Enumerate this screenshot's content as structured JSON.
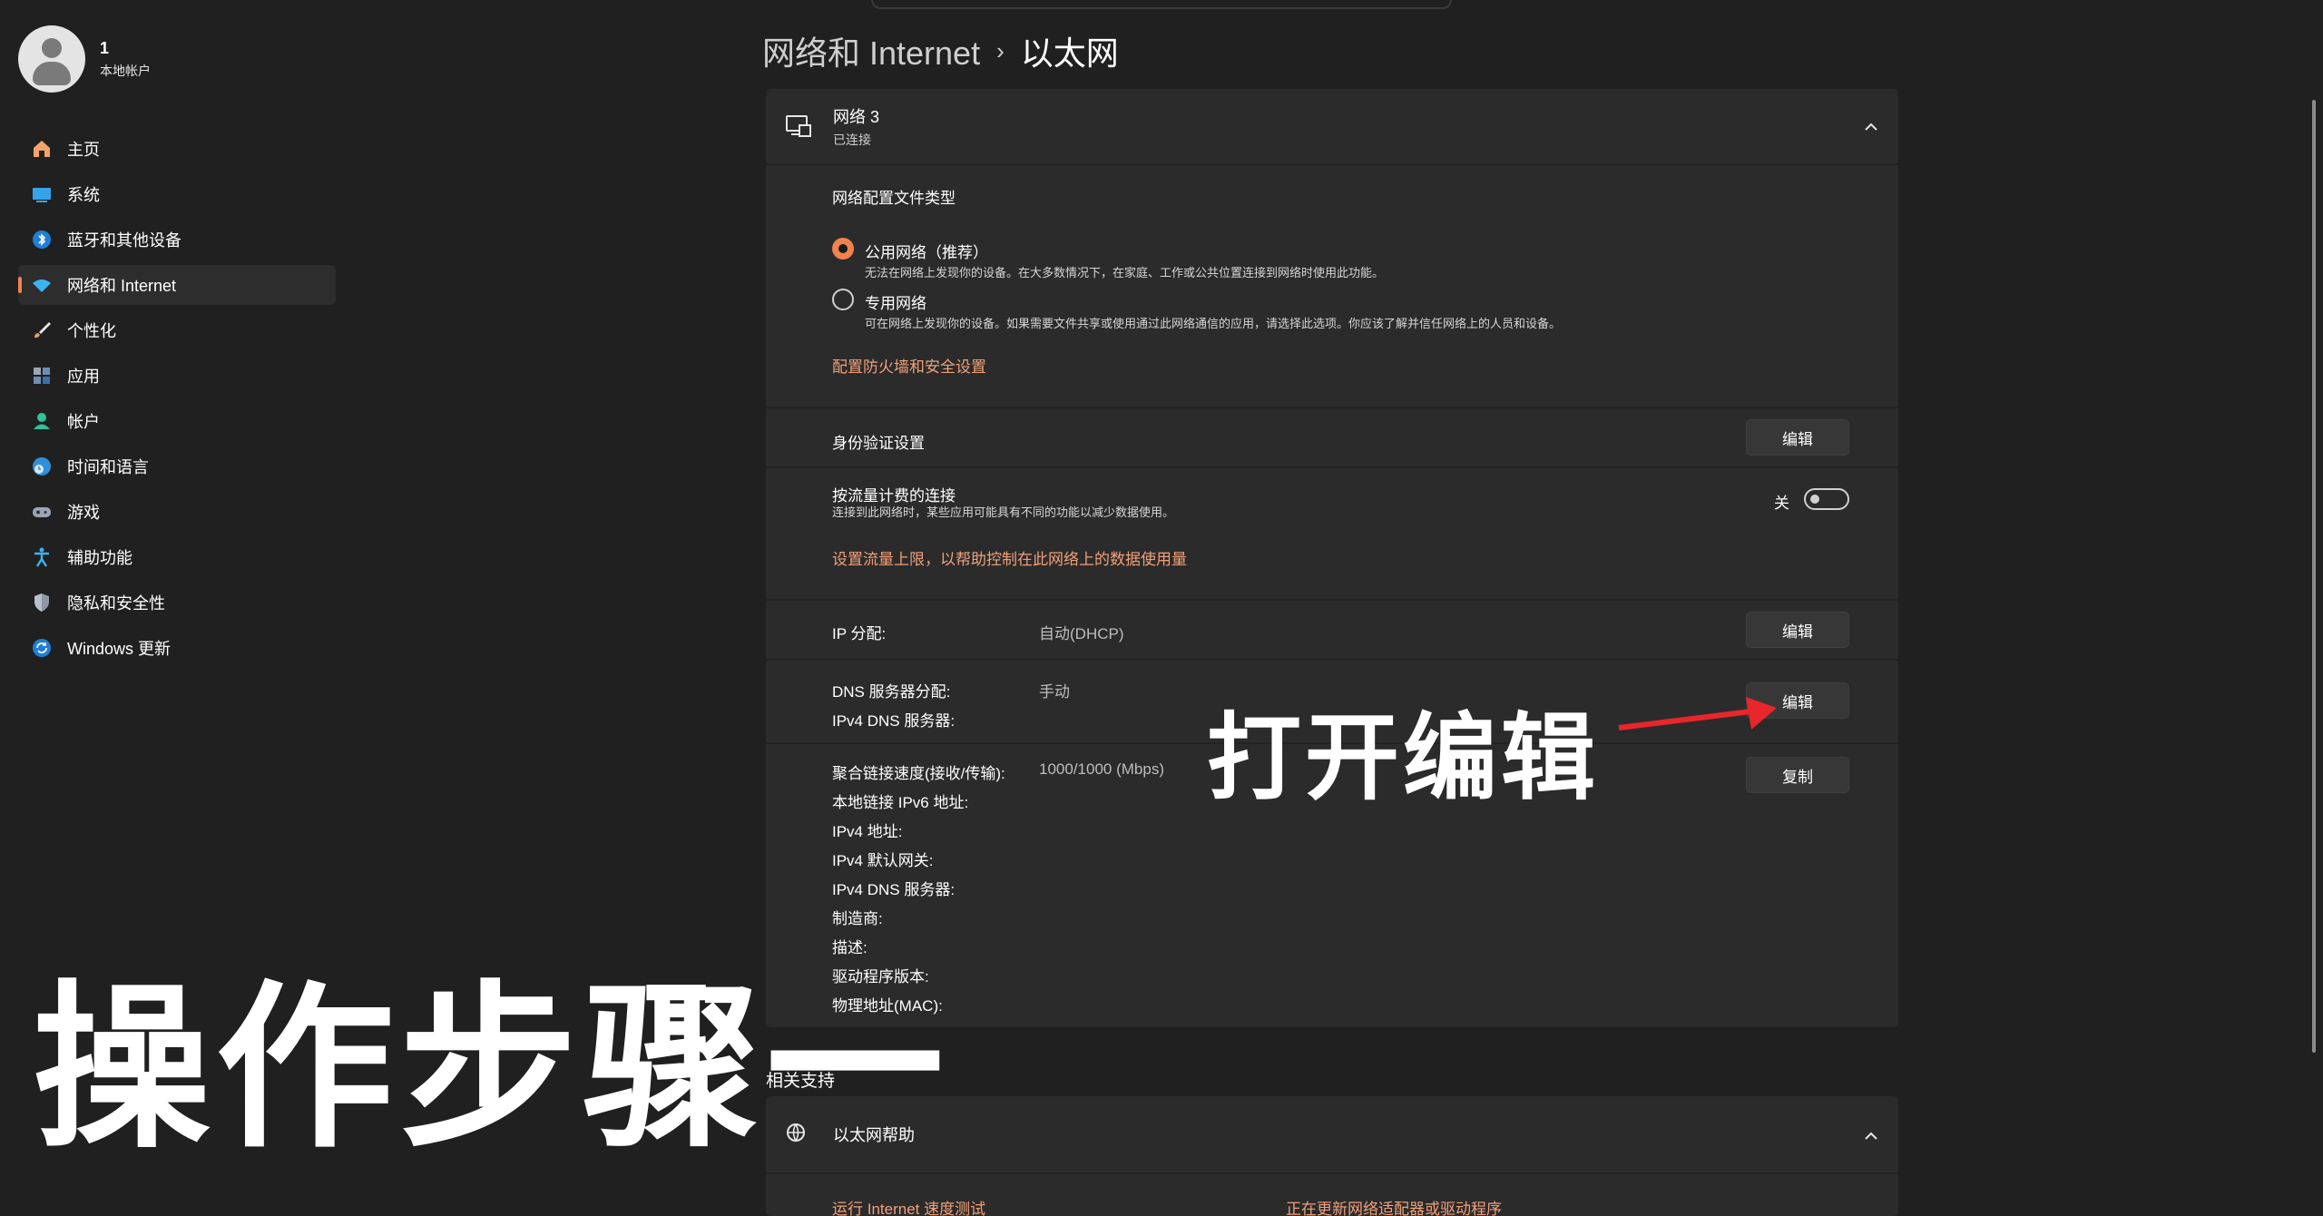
{
  "user": {
    "name": "1",
    "account_type": "本地帐户"
  },
  "nav": [
    {
      "label": "主页",
      "icon": "home-icon",
      "active": false
    },
    {
      "label": "系统",
      "icon": "system-icon",
      "active": false
    },
    {
      "label": "蓝牙和其他设备",
      "icon": "bluetooth-icon",
      "active": false
    },
    {
      "label": "网络和 Internet",
      "icon": "wifi-icon",
      "active": true
    },
    {
      "label": "个性化",
      "icon": "brush-icon",
      "active": false
    },
    {
      "label": "应用",
      "icon": "apps-icon",
      "active": false
    },
    {
      "label": "帐户",
      "icon": "account-icon",
      "active": false
    },
    {
      "label": "时间和语言",
      "icon": "globe-clock-icon",
      "active": false
    },
    {
      "label": "游戏",
      "icon": "gamepad-icon",
      "active": false
    },
    {
      "label": "辅助功能",
      "icon": "accessibility-icon",
      "active": false
    },
    {
      "label": "隐私和安全性",
      "icon": "shield-icon",
      "active": false
    },
    {
      "label": "Windows 更新",
      "icon": "update-icon",
      "active": false
    }
  ],
  "breadcrumb": {
    "parent": "网络和 Internet",
    "separator": "›",
    "current": "以太网"
  },
  "network": {
    "name": "网络 3",
    "status": "已连接",
    "profile_type_label": "网络配置文件类型",
    "public": {
      "label": "公用网络（推荐）",
      "desc": "无法在网络上发现你的设备。在大多数情况下，在家庭、工作或公共位置连接到网络时使用此功能。",
      "selected": true
    },
    "private": {
      "label": "专用网络",
      "desc": "可在网络上发现你的设备。如果需要文件共享或使用通过此网络通信的应用，请选择此选项。你应该了解并信任网络上的人员和设备。",
      "selected": false
    },
    "firewall_link": "配置防火墙和安全设置",
    "auth_label": "身份验证设置",
    "auth_button": "编辑",
    "metered_label": "按流量计费的连接",
    "metered_desc": "连接到此网络时，某些应用可能具有不同的功能以减少数据使用。",
    "metered_state": "关",
    "data_limit_link": "设置流量上限，以帮助控制在此网络上的数据使用量",
    "ip_label": "IP 分配:",
    "ip_value": "自动(DHCP)",
    "ip_button": "编辑",
    "dns_label": "DNS 服务器分配:",
    "dns_value": "手动",
    "ipv4_dns_label": "IPv4 DNS 服务器:",
    "dns_button": "编辑",
    "copy_button": "复制",
    "props": [
      {
        "label": "聚合链接速度(接收/传输):",
        "value": "1000/1000 (Mbps)"
      },
      {
        "label": "本地链接 IPv6 地址:",
        "value": ""
      },
      {
        "label": "IPv4 地址:",
        "value": ""
      },
      {
        "label": "IPv4 默认网关:",
        "value": ""
      },
      {
        "label": "IPv4 DNS 服务器:",
        "value": ""
      },
      {
        "label": "制造商:",
        "value": ""
      },
      {
        "label": "描述:",
        "value": ""
      },
      {
        "label": "驱动程序版本:",
        "value": ""
      },
      {
        "label": "物理地址(MAC):",
        "value": ""
      }
    ]
  },
  "related": {
    "heading": "相关支持",
    "help_title": "以太网帮助",
    "link_speed_test": "运行 Internet 速度测试",
    "link_driver": "正在更新网络适配器或驱动程序"
  },
  "annotation": {
    "text": "打开编辑",
    "arrow_color": "#e8262b"
  },
  "caption": "操作步骤一",
  "colors": {
    "accent": "#f0834f",
    "link": "#f0a07a",
    "bg": "#202020",
    "card": "#2b2b2b"
  }
}
